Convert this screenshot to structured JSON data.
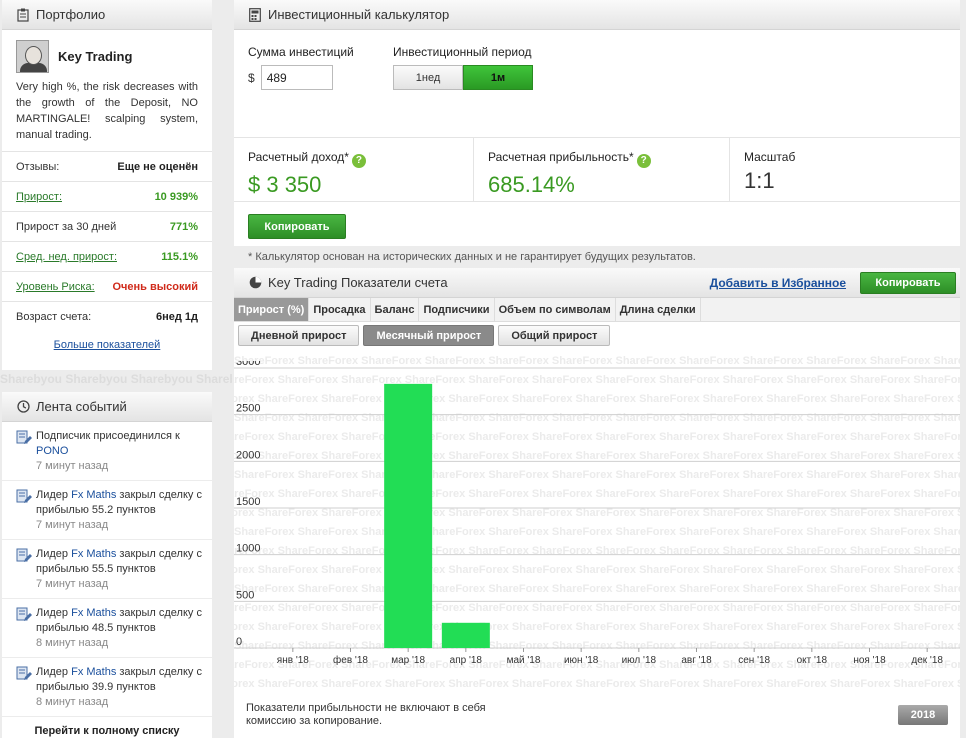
{
  "portfolio": {
    "title": "Портфолио",
    "trader_name": "Key Trading",
    "description": "Very high %, the risk decreases with the growth of the Deposit, NO MARTINGALE! scalping system, manual trading.",
    "stats": [
      {
        "label": "Отзывы:",
        "value": "Еще не оценён"
      },
      {
        "label": "Прирост:",
        "value": "10 939%"
      },
      {
        "label": "Прирост за 30 дней",
        "value": "771%"
      },
      {
        "label": "Сред. нед. прирост:",
        "value": "115.1%"
      },
      {
        "label": "Уровень Риска:",
        "value": "Очень высокий"
      },
      {
        "label": "Возраст счета:",
        "value": "6нед 1д"
      }
    ],
    "more_link": "Больше показателей"
  },
  "feed": {
    "title": "Лента событий",
    "events": [
      {
        "pre": "Подписчик присоединился к",
        "link": "PONO",
        "post": "",
        "time": "7 минут назад"
      },
      {
        "pre": "Лидер",
        "link": "Fx Maths",
        "post": "закрыл сделку с прибылью 55.2 пунктов",
        "time": "7 минут назад"
      },
      {
        "pre": "Лидер",
        "link": "Fx Maths",
        "post": "закрыл сделку с прибылью 55.5 пунктов",
        "time": "7 минут назад"
      },
      {
        "pre": "Лидер",
        "link": "Fx Maths",
        "post": "закрыл сделку с прибылью 48.5 пунктов",
        "time": "8 минут назад"
      },
      {
        "pre": "Лидер",
        "link": "Fx Maths",
        "post": "закрыл сделку с прибылью 39.9 пунктов",
        "time": "8 минут назад"
      }
    ],
    "all_link": "Перейти к полному списку"
  },
  "calc": {
    "title": "Инвестиционный калькулятор",
    "sum_label": "Сумма инвестиций",
    "currency": "$",
    "sum_value": "489",
    "period_label": "Инвестиционный период",
    "periods": [
      "1нед",
      "1м"
    ],
    "selected_period": "1м",
    "income_label": "Расчетный доход*",
    "income_value": "$ 3 350",
    "profit_label": "Расчетная прибыльность*",
    "profit_value": "685.14%",
    "scale_label": "Масштаб",
    "scale_value": "1:1",
    "copy_button": "Копировать",
    "note": "* Калькулятор основан на исторических данных и не гарантирует будущих результатов."
  },
  "stats_panel": {
    "title": "Key Trading Показатели счета",
    "fav_link": "Добавить в Избранное",
    "copy_button": "Копировать",
    "tabs": [
      "Прирост (%)",
      "Просадка",
      "Баланс",
      "Подписчики",
      "Объем по символам",
      "Длина сделки"
    ],
    "active_tab": "Прирост (%)",
    "subtabs": [
      "Дневной прирост",
      "Месячный прирост",
      "Общий прирост"
    ],
    "active_subtab": "Месячный прирост",
    "footnote": "Показатели прибыльности не включают в себя комиссию за копирование.",
    "year": "2018",
    "watermark": "ShareForex"
  },
  "chart_data": {
    "type": "bar",
    "categories": [
      "янв '18",
      "фев '18",
      "мар '18",
      "апр '18",
      "май '18",
      "июн '18",
      "июл '18",
      "авг '18",
      "сен '18",
      "окт '18",
      "ноя '18",
      "дек '18"
    ],
    "values": [
      0,
      0,
      2830,
      270,
      0,
      0,
      0,
      0,
      0,
      0,
      0,
      0
    ],
    "yticks": [
      0,
      500,
      1000,
      1500,
      2000,
      2500,
      3000
    ],
    "ylim": [
      0,
      3000
    ],
    "bar_color": "#22dd55",
    "grid": true
  },
  "colors": {
    "accent_green": "#3a9a22",
    "link_blue": "#1a4f9c",
    "risk_red": "#d02a1a"
  }
}
